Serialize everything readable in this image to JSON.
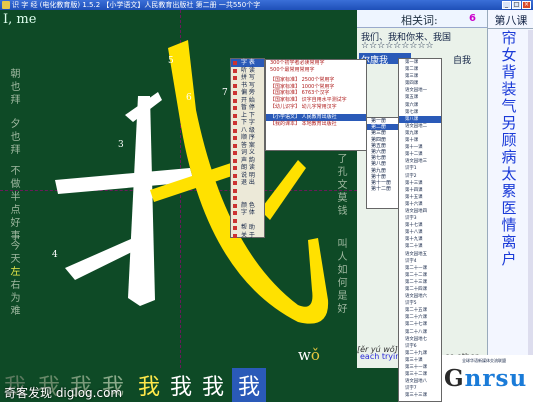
{
  "window": {
    "title": "识 字 经 (电化教育版) 1.5.2    【小学语文】人民教育出版社 第二册   一共550个字",
    "controls": [
      "_",
      "□",
      "×"
    ]
  },
  "canvas": {
    "hint": "I, me",
    "left_vertical": [
      "朝也拜",
      "夕也拜",
      "不做半点好事",
      "今天左右为难"
    ],
    "left_highlight": "左",
    "right_vertical": [
      "为了孔文莫钱",
      "叫人如何是好"
    ],
    "big_char": "我",
    "stroke_numbers": [
      "1",
      "2",
      "3",
      "4",
      "5",
      "6",
      "7"
    ],
    "pinyin_prefix": "w",
    "pinyin_tone": "ǒ"
  },
  "related": {
    "label": "相关词:",
    "count": "6"
  },
  "words": {
    "line1": "我们、我和你来、我国",
    "line2": "☆☆☆☆☆☆☆☆☆",
    "selected": "尔康我",
    "line3": "自我",
    "phonetic": "[ěr yú wǒ]",
    "sentence": "each trying",
    "sentence_tail": "se other"
  },
  "lesson": {
    "title": "第八课",
    "chars": [
      "帘",
      "女",
      "背",
      "装",
      "气",
      "另",
      "顾",
      "病",
      "太",
      "累",
      "医",
      "情",
      "离",
      "户"
    ]
  },
  "brand": {
    "tiny": "全球华语新媒体交流联盟",
    "name_g": "G",
    "name_rest": "nrsu"
  },
  "strip": {
    "chars": [
      "我",
      "我",
      "我",
      "我",
      "我",
      "我",
      "我",
      "我"
    ]
  },
  "watermark": "奇客发现 diglog.com",
  "menu1": {
    "items": [
      "字 表",
      "听 读",
      "拼 写",
      "书 写",
      "偏 旁",
      "开 始",
      "暂 停",
      "上 下",
      "下 字",
      "八 级",
      "顺 序",
      "答 案",
      "词 义",
      "声 韵",
      "朗 读",
      "说 明",
      "退 出",
      "",
      "",
      "颜 色",
      "字 体",
      "",
      "帮 助",
      "关 于"
    ],
    "selected_index": 0
  },
  "menu2": {
    "items": [
      "300个初学者必读常用字",
      "500个最常用常用字",
      "",
      "【国家标准】 2500个常用字",
      "【国家标准】 1000个常用字",
      "【国家标准】 6763个汉字",
      "【国家标准】 识字自用水平测试字",
      "【幼儿识字】 幼儿字常用汉字",
      "",
      "【小学语文】 人民教育出版社",
      "【我的课本】 本地教育出版社"
    ],
    "selected_index": 9
  },
  "menu3": {
    "items": [
      "第一册",
      "第二册",
      "第三册",
      "第四册",
      "第五册",
      "第六册",
      "第七册",
      "第八册",
      "第九册",
      "第十册",
      "第十一册",
      "第十二册"
    ],
    "selected_index": 1
  },
  "menu4": {
    "items": [
      "第一课",
      "第二课",
      "第三课",
      "第四课",
      "语文园地一",
      "第五课",
      "第六课",
      "第七课",
      "第八课",
      "语文园地二",
      "第九课",
      "第十课",
      "第十一课",
      "第十二课",
      "语文园地三",
      "识字1",
      "识字2",
      "第十三课",
      "第十四课",
      "第十五课",
      "第十六课",
      "语文园地四",
      "识字3",
      "第十七课",
      "第十八课",
      "第十九课",
      "第二十课",
      "语文园地五",
      "识字4",
      "第二十一课",
      "第二十二课",
      "第二十三课",
      "第二十四课",
      "语文园地六",
      "识字5",
      "第二十五课",
      "第二十六课",
      "第二十七课",
      "第二十八课",
      "语文园地七",
      "识字6",
      "第二十九课",
      "第三十课",
      "第三十一课",
      "第三十二课",
      "语文园地八",
      "识字7",
      "第三十三课"
    ],
    "selected_index": 8
  }
}
